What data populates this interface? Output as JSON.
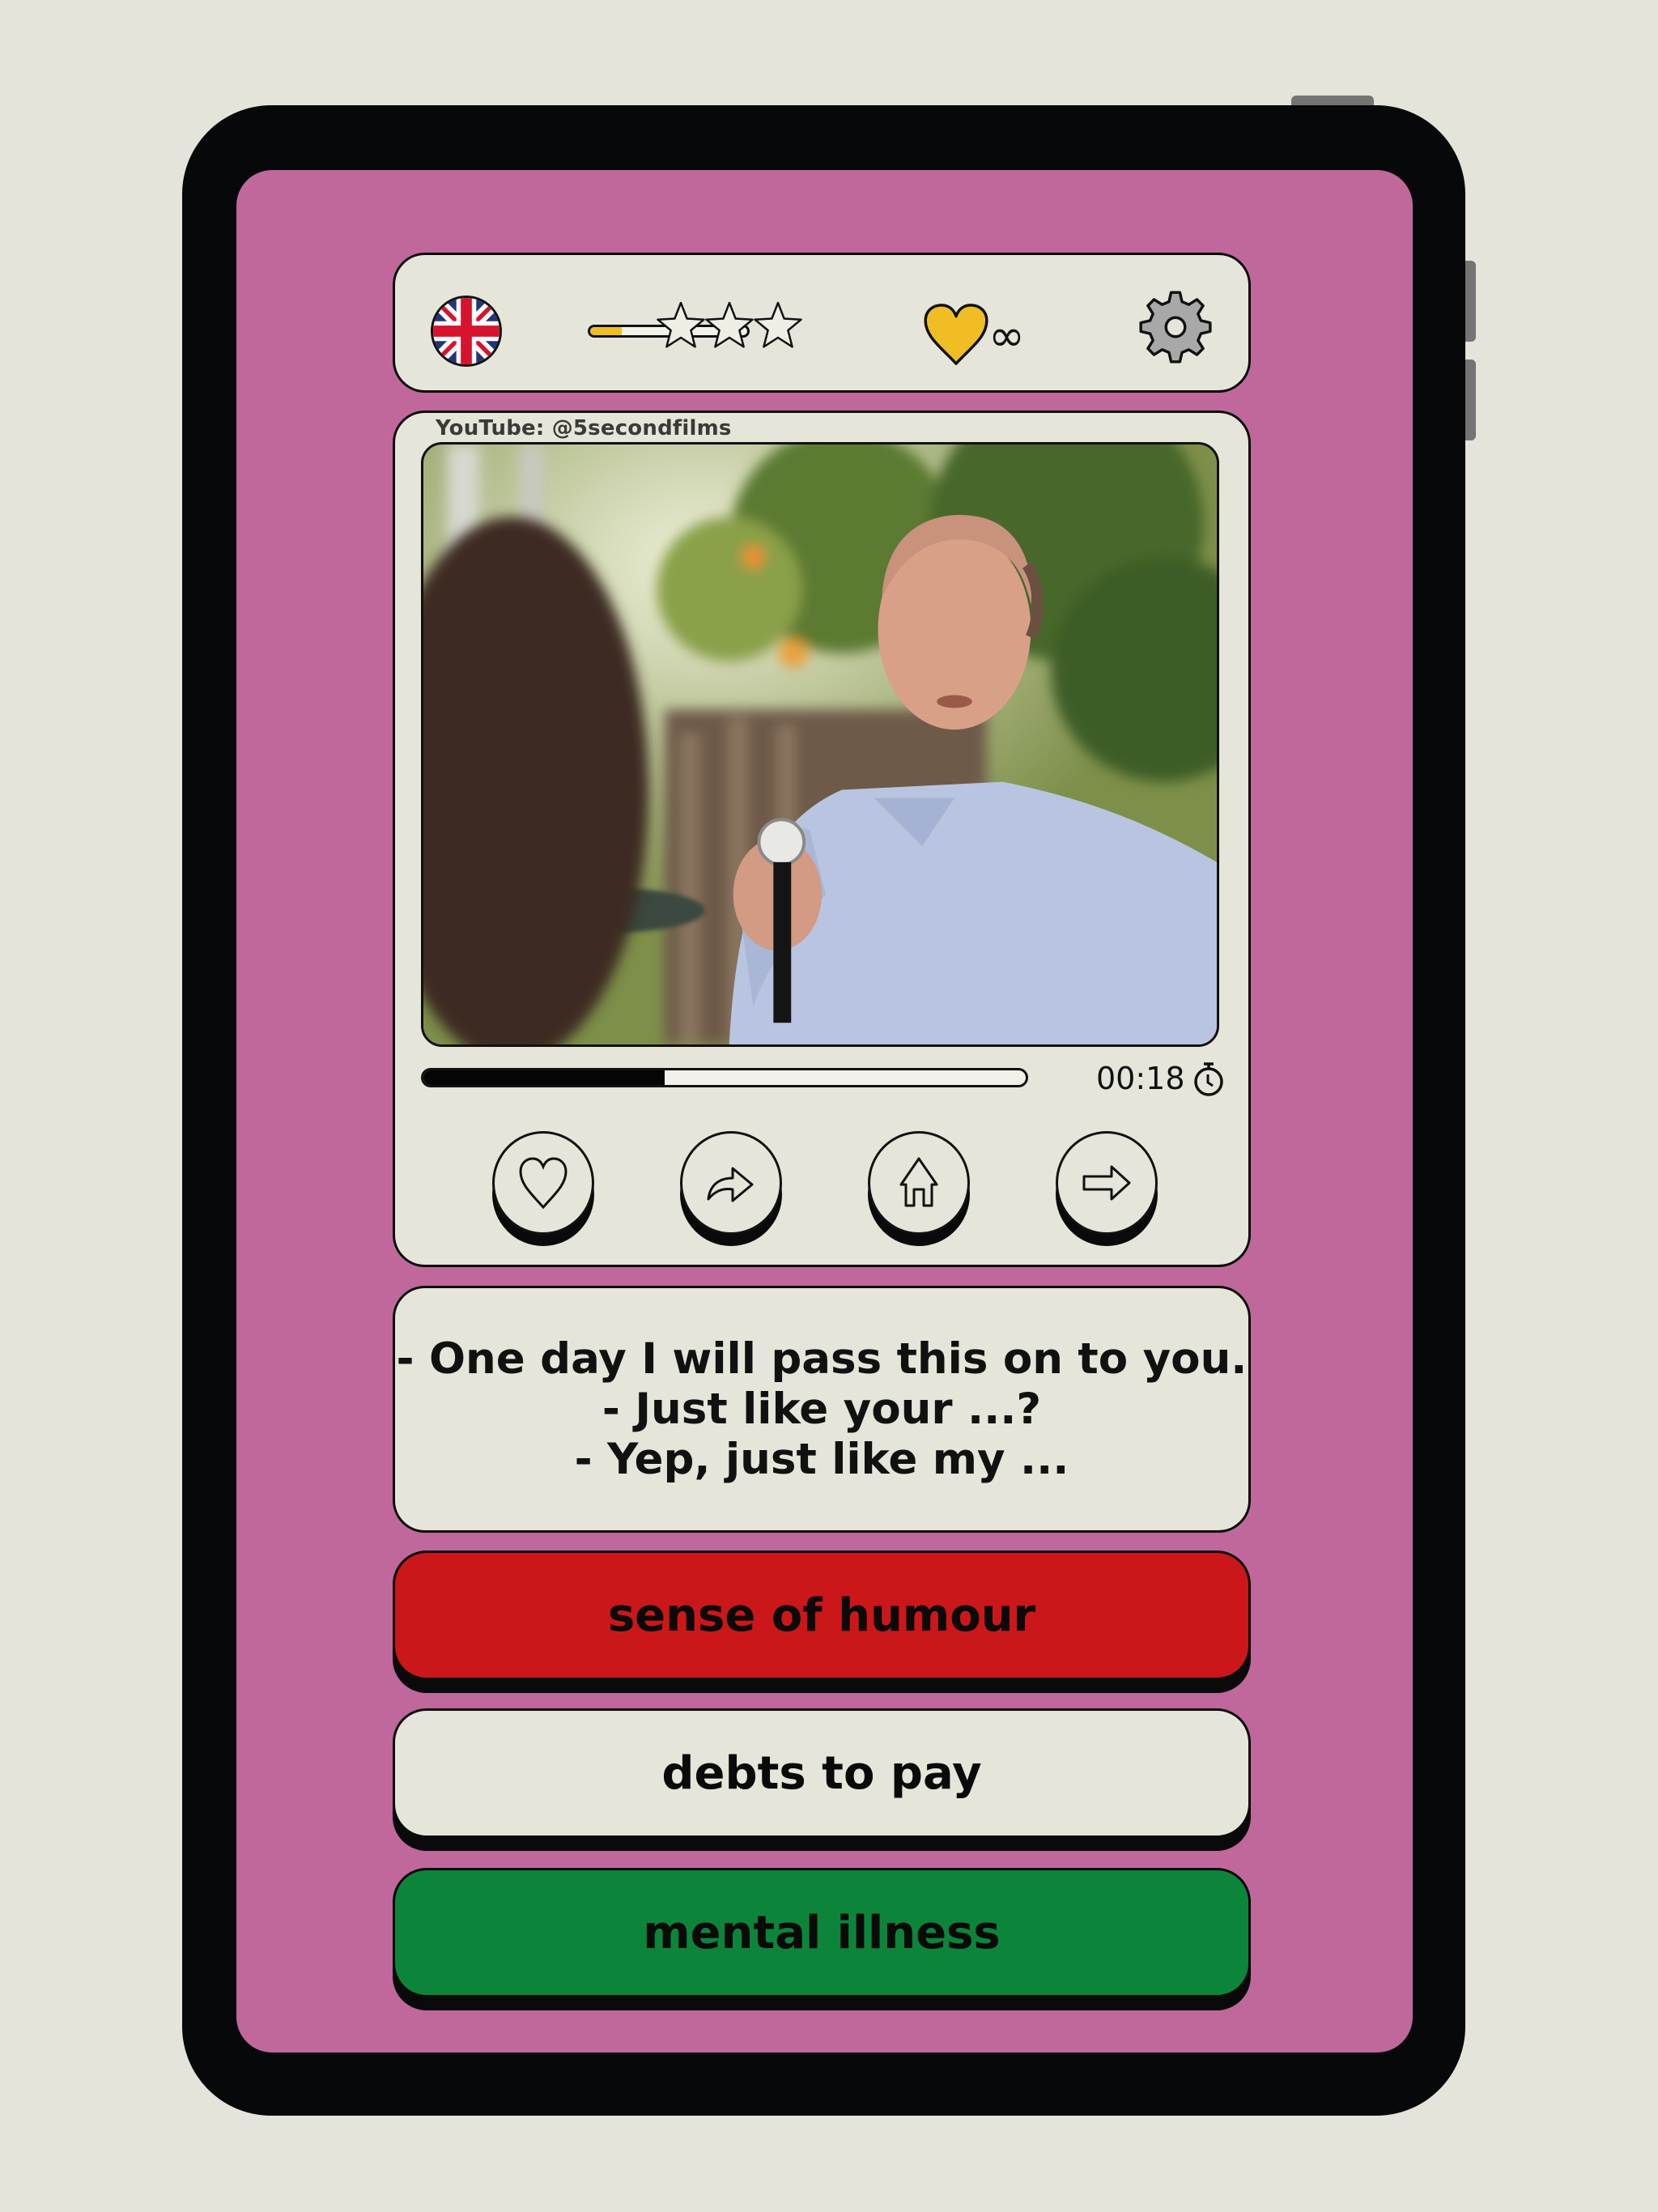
{
  "colors": {
    "page_bg": "#e4e4da",
    "screen_bg": "#c0679c",
    "card_bg": "#e5e5da",
    "accent_yellow": "#f0be24",
    "wrong": "#cb1719",
    "neutral": "#e5e5da",
    "correct": "#0c853a"
  },
  "topbar": {
    "language": "English (UK)",
    "language_icon": "uk-flag-icon",
    "level_progress_percent": 20,
    "stars_total": 3,
    "stars_earned": 0,
    "lives_icon": "heart-icon",
    "lives_value": "∞",
    "settings_icon": "gear-icon"
  },
  "video": {
    "source": "YouTube: @5secondfilms",
    "progress_percent": 40,
    "time": "00:18",
    "timer_icon": "stopwatch-icon"
  },
  "controls": [
    {
      "name": "like",
      "icon": "heart-outline-icon"
    },
    {
      "name": "share",
      "icon": "share-arrow-icon"
    },
    {
      "name": "home",
      "icon": "home-icon"
    },
    {
      "name": "next",
      "icon": "arrow-right-icon"
    }
  ],
  "subtitles": [
    "- One day I will pass this on to you.",
    "- Just like your ...?",
    "- Yep, just like my ..."
  ],
  "options": [
    {
      "label": "sense of humour",
      "state": "wrong"
    },
    {
      "label": "debts to pay",
      "state": "neutral"
    },
    {
      "label": "mental illness",
      "state": "correct"
    }
  ]
}
